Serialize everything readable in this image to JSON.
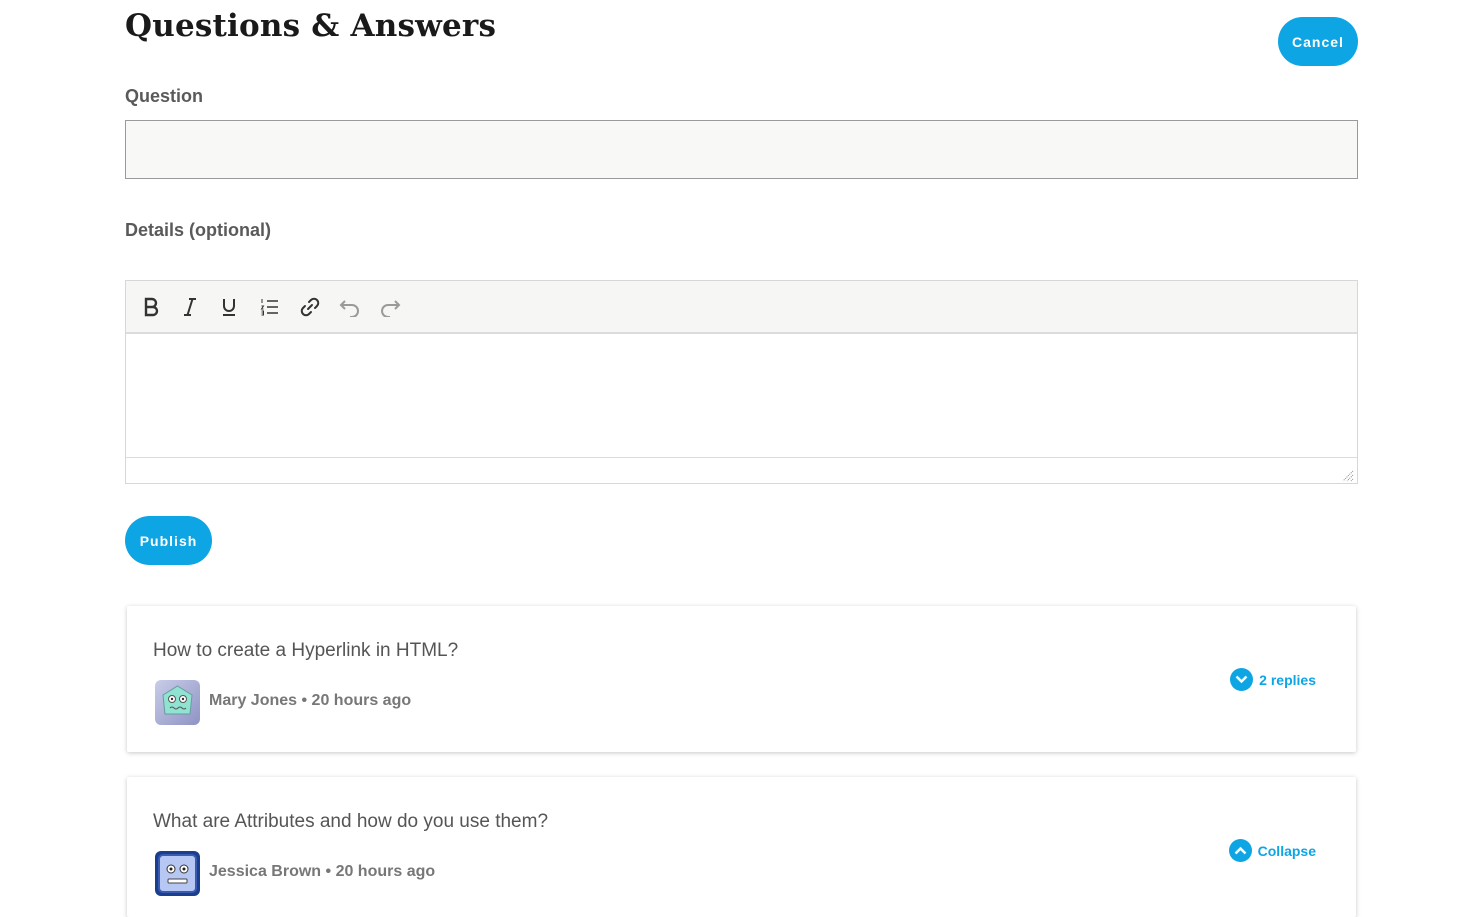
{
  "header": {
    "title": "Questions & Answers",
    "cancel_label": "Cancel"
  },
  "form": {
    "question_label": "Question",
    "question_value": "",
    "details_label": "Details (optional)",
    "details_value": "",
    "publish_label": "Publish",
    "toolbar": [
      "bold-icon",
      "italic-icon",
      "underline-icon",
      "ordered-list-icon",
      "link-icon",
      "undo-icon",
      "redo-icon"
    ]
  },
  "questions": [
    {
      "text": "How to create a Hyperlink in HTML?",
      "author": "Mary Jones",
      "time": "20 hours ago",
      "toggle_label": "2 replies",
      "toggle_icon": "chevron-down-icon"
    },
    {
      "text": "What are Attributes and how do you use them?",
      "author": "Jessica Brown",
      "time": "20 hours ago",
      "toggle_label": "Collapse",
      "toggle_icon": "chevron-up-icon"
    }
  ],
  "colors": {
    "accent": "#0ea5e4",
    "title": "#1a1a1a",
    "label": "#5a5a5a",
    "meta": "#777777"
  }
}
